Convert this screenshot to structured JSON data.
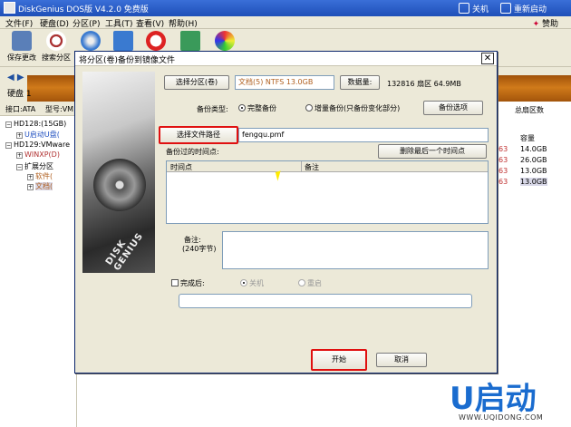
{
  "window": {
    "title": "DiskGenius DOS版 V4.2.0 免费版",
    "shutdown_label": "关机",
    "restart_label": "重新启动"
  },
  "menu": {
    "items": [
      "文件(F)",
      "硬盘(D)",
      "分区(P)",
      "工具(T)",
      "查看(V)",
      "帮助(H)"
    ],
    "sponsor": "赞助"
  },
  "toolbar": {
    "items": [
      "保存更改",
      "搜索分区"
    ]
  },
  "disk_panel": {
    "disk_label": "硬盘 1",
    "interface_label": "接口:ATA",
    "model_label": "型号:VM"
  },
  "tree": {
    "items": [
      "HD128:(15GB)",
      "U启动U盘(",
      "HD129:VMware",
      "WINXP(D)",
      "扩展分区",
      "软件(",
      "文档("
    ]
  },
  "right_table": {
    "col_total_sectors": "总扇区数",
    "col_capacity": "容量",
    "rows": [
      {
        "sector_suffix": "63",
        "capacity": "14.0GB"
      },
      {
        "sector_suffix": "63",
        "capacity": "26.0GB"
      },
      {
        "sector_suffix": "63",
        "capacity": "13.0GB"
      },
      {
        "sector_suffix": "63",
        "capacity": "13.0GB"
      }
    ]
  },
  "dialog": {
    "title": "将分区(卷)备份到镜像文件",
    "select_partition_button": "选择分区(卷)",
    "partition_value": "文档(5) NTFS 13.0GB",
    "data_amount_label": "数据量:",
    "data_amount_value": "132816 扇区  64.9MB",
    "backup_type_label": "备份类型:",
    "full_backup_label": "完整备份",
    "incremental_backup_label": "增量备份(只备份变化部分)",
    "backup_options_button": "备份选项",
    "select_path_button": "选择文件路径",
    "file_path_value": "fengqu.pmf",
    "backup_times_label": "备份过的时间点:",
    "delete_last_button": "删除最后一个时间点",
    "col_time": "时间点",
    "col_note": "备注",
    "note_label": "备注:",
    "note_hint": "(240字节)",
    "after_done_label": "完成后:",
    "shutdown_option": "关机",
    "restart_option": "重启",
    "start_button": "开始",
    "cancel_button": "取消"
  },
  "logo": {
    "text": "U启动",
    "url": "WWW.UQIDONG.COM"
  },
  "colors": {
    "title_bar": "#1e4fb8",
    "highlight": "#e01010",
    "disk_bar": "#c06a14",
    "logo_blue": "#1a6ccf"
  }
}
